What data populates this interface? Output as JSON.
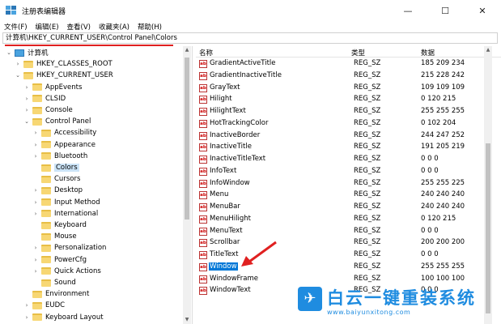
{
  "window": {
    "title": "注册表编辑器",
    "minimize": "—",
    "maximize": "☐",
    "close": "✕"
  },
  "menu": [
    "文件(F)",
    "编辑(E)",
    "查看(V)",
    "收藏夹(A)",
    "帮助(H)"
  ],
  "address": "计算机\\HKEY_CURRENT_USER\\Control Panel\\Colors",
  "tree": [
    {
      "label": "计算机",
      "twisty": "⌄",
      "icon": "computer-icon",
      "indent": 1,
      "name": "tree-computer"
    },
    {
      "label": "HKEY_CLASSES_ROOT",
      "twisty": "›",
      "icon": "folder-icon",
      "indent": 2,
      "name": "tree-hkcr"
    },
    {
      "label": "HKEY_CURRENT_USER",
      "twisty": "⌄",
      "icon": "folder-icon",
      "indent": 2,
      "name": "tree-hkcu"
    },
    {
      "label": "AppEvents",
      "twisty": "›",
      "icon": "folder-icon",
      "indent": 3,
      "name": "tree-appevents"
    },
    {
      "label": "CLSID",
      "twisty": "›",
      "icon": "folder-icon",
      "indent": 3,
      "name": "tree-clsid"
    },
    {
      "label": "Console",
      "twisty": "›",
      "icon": "folder-icon",
      "indent": 3,
      "name": "tree-console"
    },
    {
      "label": "Control Panel",
      "twisty": "⌄",
      "icon": "folder-icon",
      "indent": 3,
      "name": "tree-control-panel"
    },
    {
      "label": "Accessibility",
      "twisty": "›",
      "icon": "folder-icon",
      "indent": 4,
      "name": "tree-accessibility"
    },
    {
      "label": "Appearance",
      "twisty": "›",
      "icon": "folder-icon",
      "indent": 4,
      "name": "tree-appearance"
    },
    {
      "label": "Bluetooth",
      "twisty": "›",
      "icon": "folder-icon",
      "indent": 4,
      "name": "tree-bluetooth"
    },
    {
      "label": "Colors",
      "twisty": "",
      "icon": "folder-icon",
      "indent": 4,
      "name": "tree-colors",
      "selected": true
    },
    {
      "label": "Cursors",
      "twisty": "",
      "icon": "folder-icon",
      "indent": 4,
      "name": "tree-cursors"
    },
    {
      "label": "Desktop",
      "twisty": "›",
      "icon": "folder-icon",
      "indent": 4,
      "name": "tree-desktop"
    },
    {
      "label": "Input Method",
      "twisty": "›",
      "icon": "folder-icon",
      "indent": 4,
      "name": "tree-input-method"
    },
    {
      "label": "International",
      "twisty": "›",
      "icon": "folder-icon",
      "indent": 4,
      "name": "tree-international"
    },
    {
      "label": "Keyboard",
      "twisty": "",
      "icon": "folder-icon",
      "indent": 4,
      "name": "tree-keyboard"
    },
    {
      "label": "Mouse",
      "twisty": "",
      "icon": "folder-icon",
      "indent": 4,
      "name": "tree-mouse"
    },
    {
      "label": "Personalization",
      "twisty": "›",
      "icon": "folder-icon",
      "indent": 4,
      "name": "tree-personalization"
    },
    {
      "label": "PowerCfg",
      "twisty": "›",
      "icon": "folder-icon",
      "indent": 4,
      "name": "tree-powercfg"
    },
    {
      "label": "Quick Actions",
      "twisty": "›",
      "icon": "folder-icon",
      "indent": 4,
      "name": "tree-quick-actions"
    },
    {
      "label": "Sound",
      "twisty": "",
      "icon": "folder-icon",
      "indent": 4,
      "name": "tree-sound"
    },
    {
      "label": "Environment",
      "twisty": "",
      "icon": "folder-icon",
      "indent": 3,
      "name": "tree-environment"
    },
    {
      "label": "EUDC",
      "twisty": "›",
      "icon": "folder-icon",
      "indent": 3,
      "name": "tree-eudc"
    },
    {
      "label": "Keyboard Layout",
      "twisty": "›",
      "icon": "folder-icon",
      "indent": 3,
      "name": "tree-keyboard-layout"
    }
  ],
  "columns": {
    "name": "名称",
    "type": "类型",
    "data": "数据"
  },
  "values": [
    {
      "name": "GradientActiveTitle",
      "type": "REG_SZ",
      "data": "185 209 234"
    },
    {
      "name": "GradientInactiveTitle",
      "type": "REG_SZ",
      "data": "215 228 242"
    },
    {
      "name": "GrayText",
      "type": "REG_SZ",
      "data": "109 109 109"
    },
    {
      "name": "Hilight",
      "type": "REG_SZ",
      "data": "0 120 215"
    },
    {
      "name": "HilightText",
      "type": "REG_SZ",
      "data": "255 255 255"
    },
    {
      "name": "HotTrackingColor",
      "type": "REG_SZ",
      "data": "0 102 204"
    },
    {
      "name": "InactiveBorder",
      "type": "REG_SZ",
      "data": "244 247 252"
    },
    {
      "name": "InactiveTitle",
      "type": "REG_SZ",
      "data": "191 205 219"
    },
    {
      "name": "InactiveTitleText",
      "type": "REG_SZ",
      "data": "0 0 0"
    },
    {
      "name": "InfoText",
      "type": "REG_SZ",
      "data": "0 0 0"
    },
    {
      "name": "InfoWindow",
      "type": "REG_SZ",
      "data": "255 255 225"
    },
    {
      "name": "Menu",
      "type": "REG_SZ",
      "data": "240 240 240"
    },
    {
      "name": "MenuBar",
      "type": "REG_SZ",
      "data": "240 240 240"
    },
    {
      "name": "MenuHilight",
      "type": "REG_SZ",
      "data": "0 120 215"
    },
    {
      "name": "MenuText",
      "type": "REG_SZ",
      "data": "0 0 0"
    },
    {
      "name": "Scrollbar",
      "type": "REG_SZ",
      "data": "200 200 200"
    },
    {
      "name": "TitleText",
      "type": "REG_SZ",
      "data": "0 0 0"
    },
    {
      "name": "Window",
      "type": "REG_SZ",
      "data": "255 255 255",
      "selected": true
    },
    {
      "name": "WindowFrame",
      "type": "REG_SZ",
      "data": "100 100 100"
    },
    {
      "name": "WindowText",
      "type": "REG_SZ",
      "data": "0 0 0"
    }
  ],
  "value_icon_text": "ab",
  "watermark": {
    "text": "白云一键重装系统",
    "url": "www.baiyunxitong.com"
  },
  "colors": {
    "selection": "#0078d7",
    "annotation": "#e02020",
    "watermark": "#1f8ce0"
  }
}
